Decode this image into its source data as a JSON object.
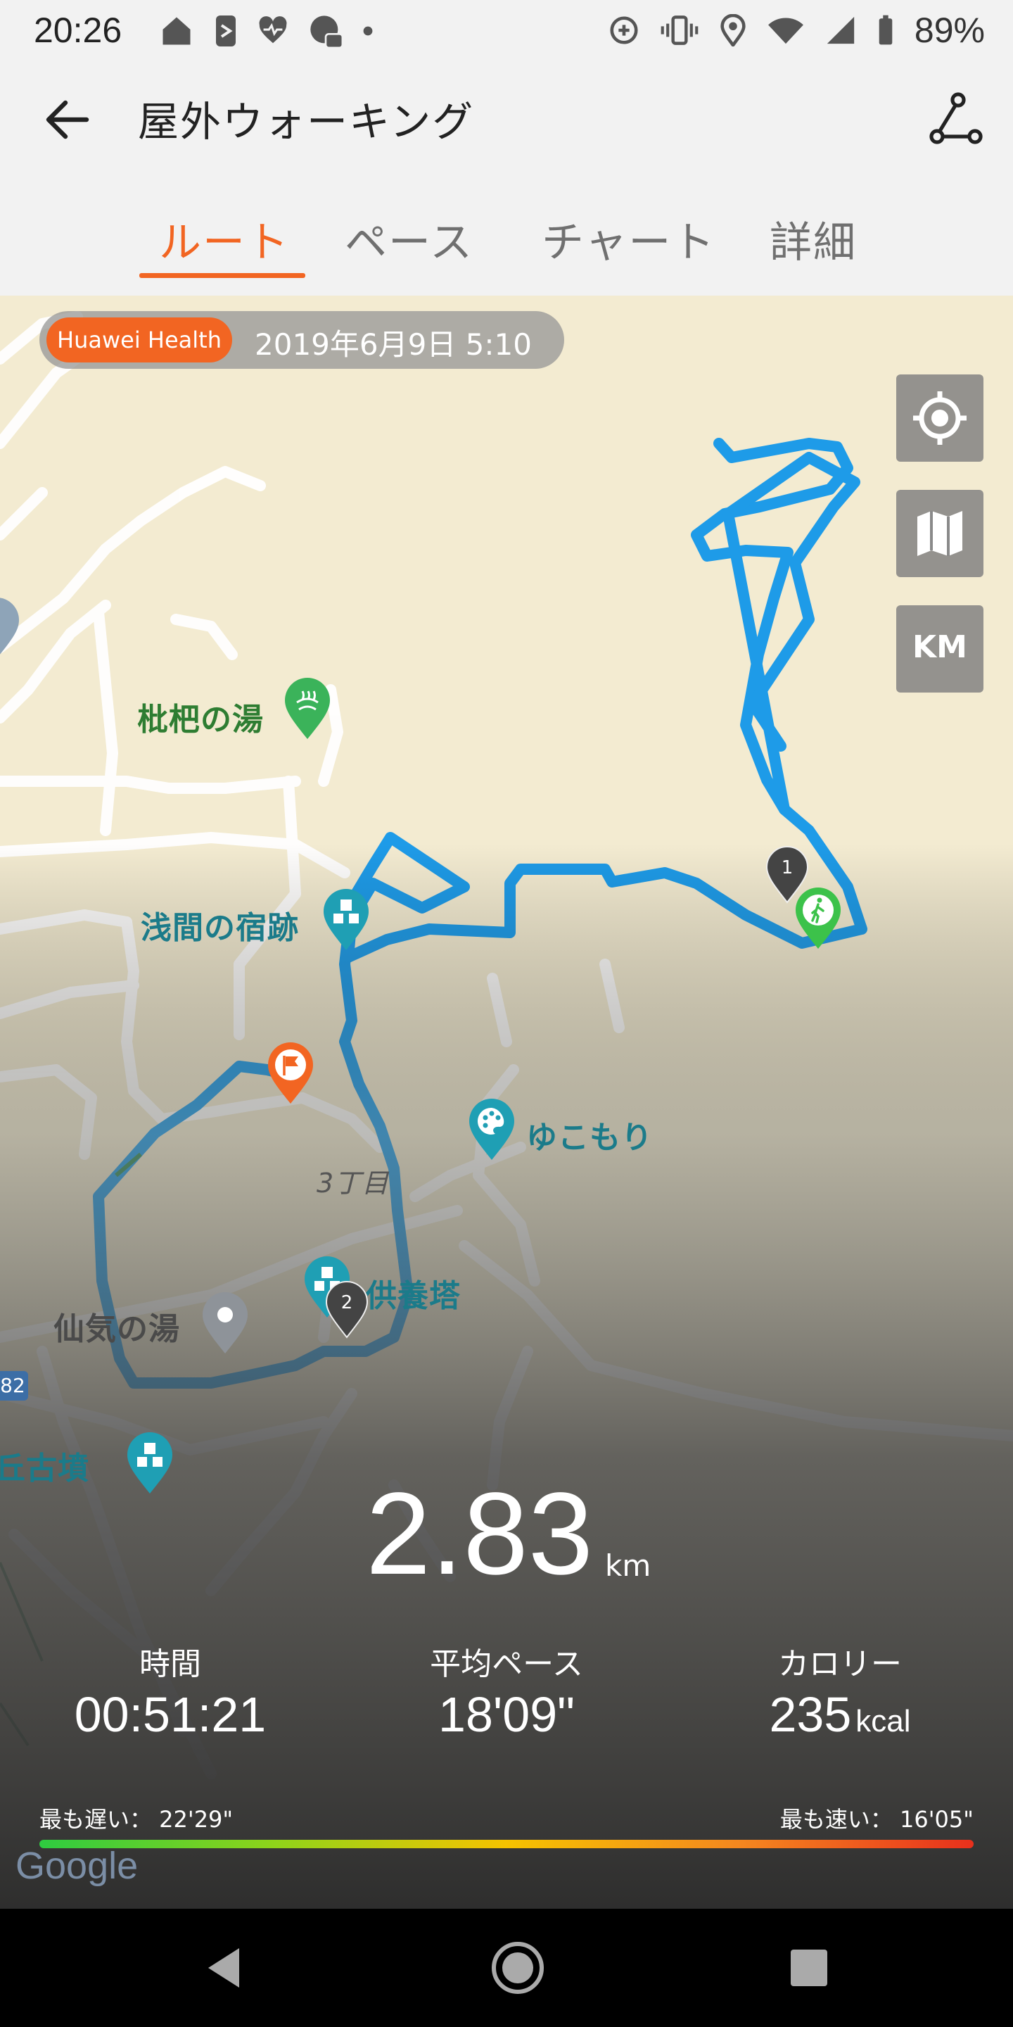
{
  "status_bar": {
    "time": "20:26",
    "battery": "89%",
    "icons_left": [
      "home-icon",
      "nfc-icon",
      "heart-rate-icon",
      "camera-icon",
      "dot-icon"
    ],
    "icons_right": [
      "data-saver-icon",
      "vibrate-icon",
      "location-icon",
      "wifi-icon",
      "signal-icon",
      "battery-icon"
    ]
  },
  "app_bar": {
    "title": "屋外ウォーキング"
  },
  "tabs": [
    {
      "label": "ルート",
      "active": true
    },
    {
      "label": "ペース",
      "active": false
    },
    {
      "label": "チャート",
      "active": false
    },
    {
      "label": "詳細",
      "active": false
    }
  ],
  "map": {
    "source_badge": "Huawei Health",
    "date": "2019年6月9日 5:10",
    "controls": {
      "km_label": "KM"
    },
    "labels": {
      "biwa": "枇杷の湯",
      "asama": "浅間の宿跡",
      "yukomori": "ゆこもり",
      "chome": "3丁目",
      "kuyoto": "供養塔",
      "senki": "仙気の湯",
      "kofun": "丘古墳",
      "road_number": "82"
    },
    "markers": {
      "km1": "1",
      "km2": "2"
    },
    "attribution": "Google",
    "route_color": "#1e9be8"
  },
  "summary": {
    "distance_value": "2.83",
    "distance_unit": "km",
    "time_label": "時間",
    "time_value": "00:51:21",
    "pace_label": "平均ペース",
    "pace_value": "18'09\"",
    "calories_label": "カロリー",
    "calories_value": "235",
    "calories_unit": "kcal",
    "slowest_label": "最も遅い： 22'29\"",
    "fastest_label": "最も速い： 16'05\""
  },
  "colors": {
    "accent": "#f26522",
    "route": "#1e9be8",
    "map_bg": "#f3ebd1"
  }
}
